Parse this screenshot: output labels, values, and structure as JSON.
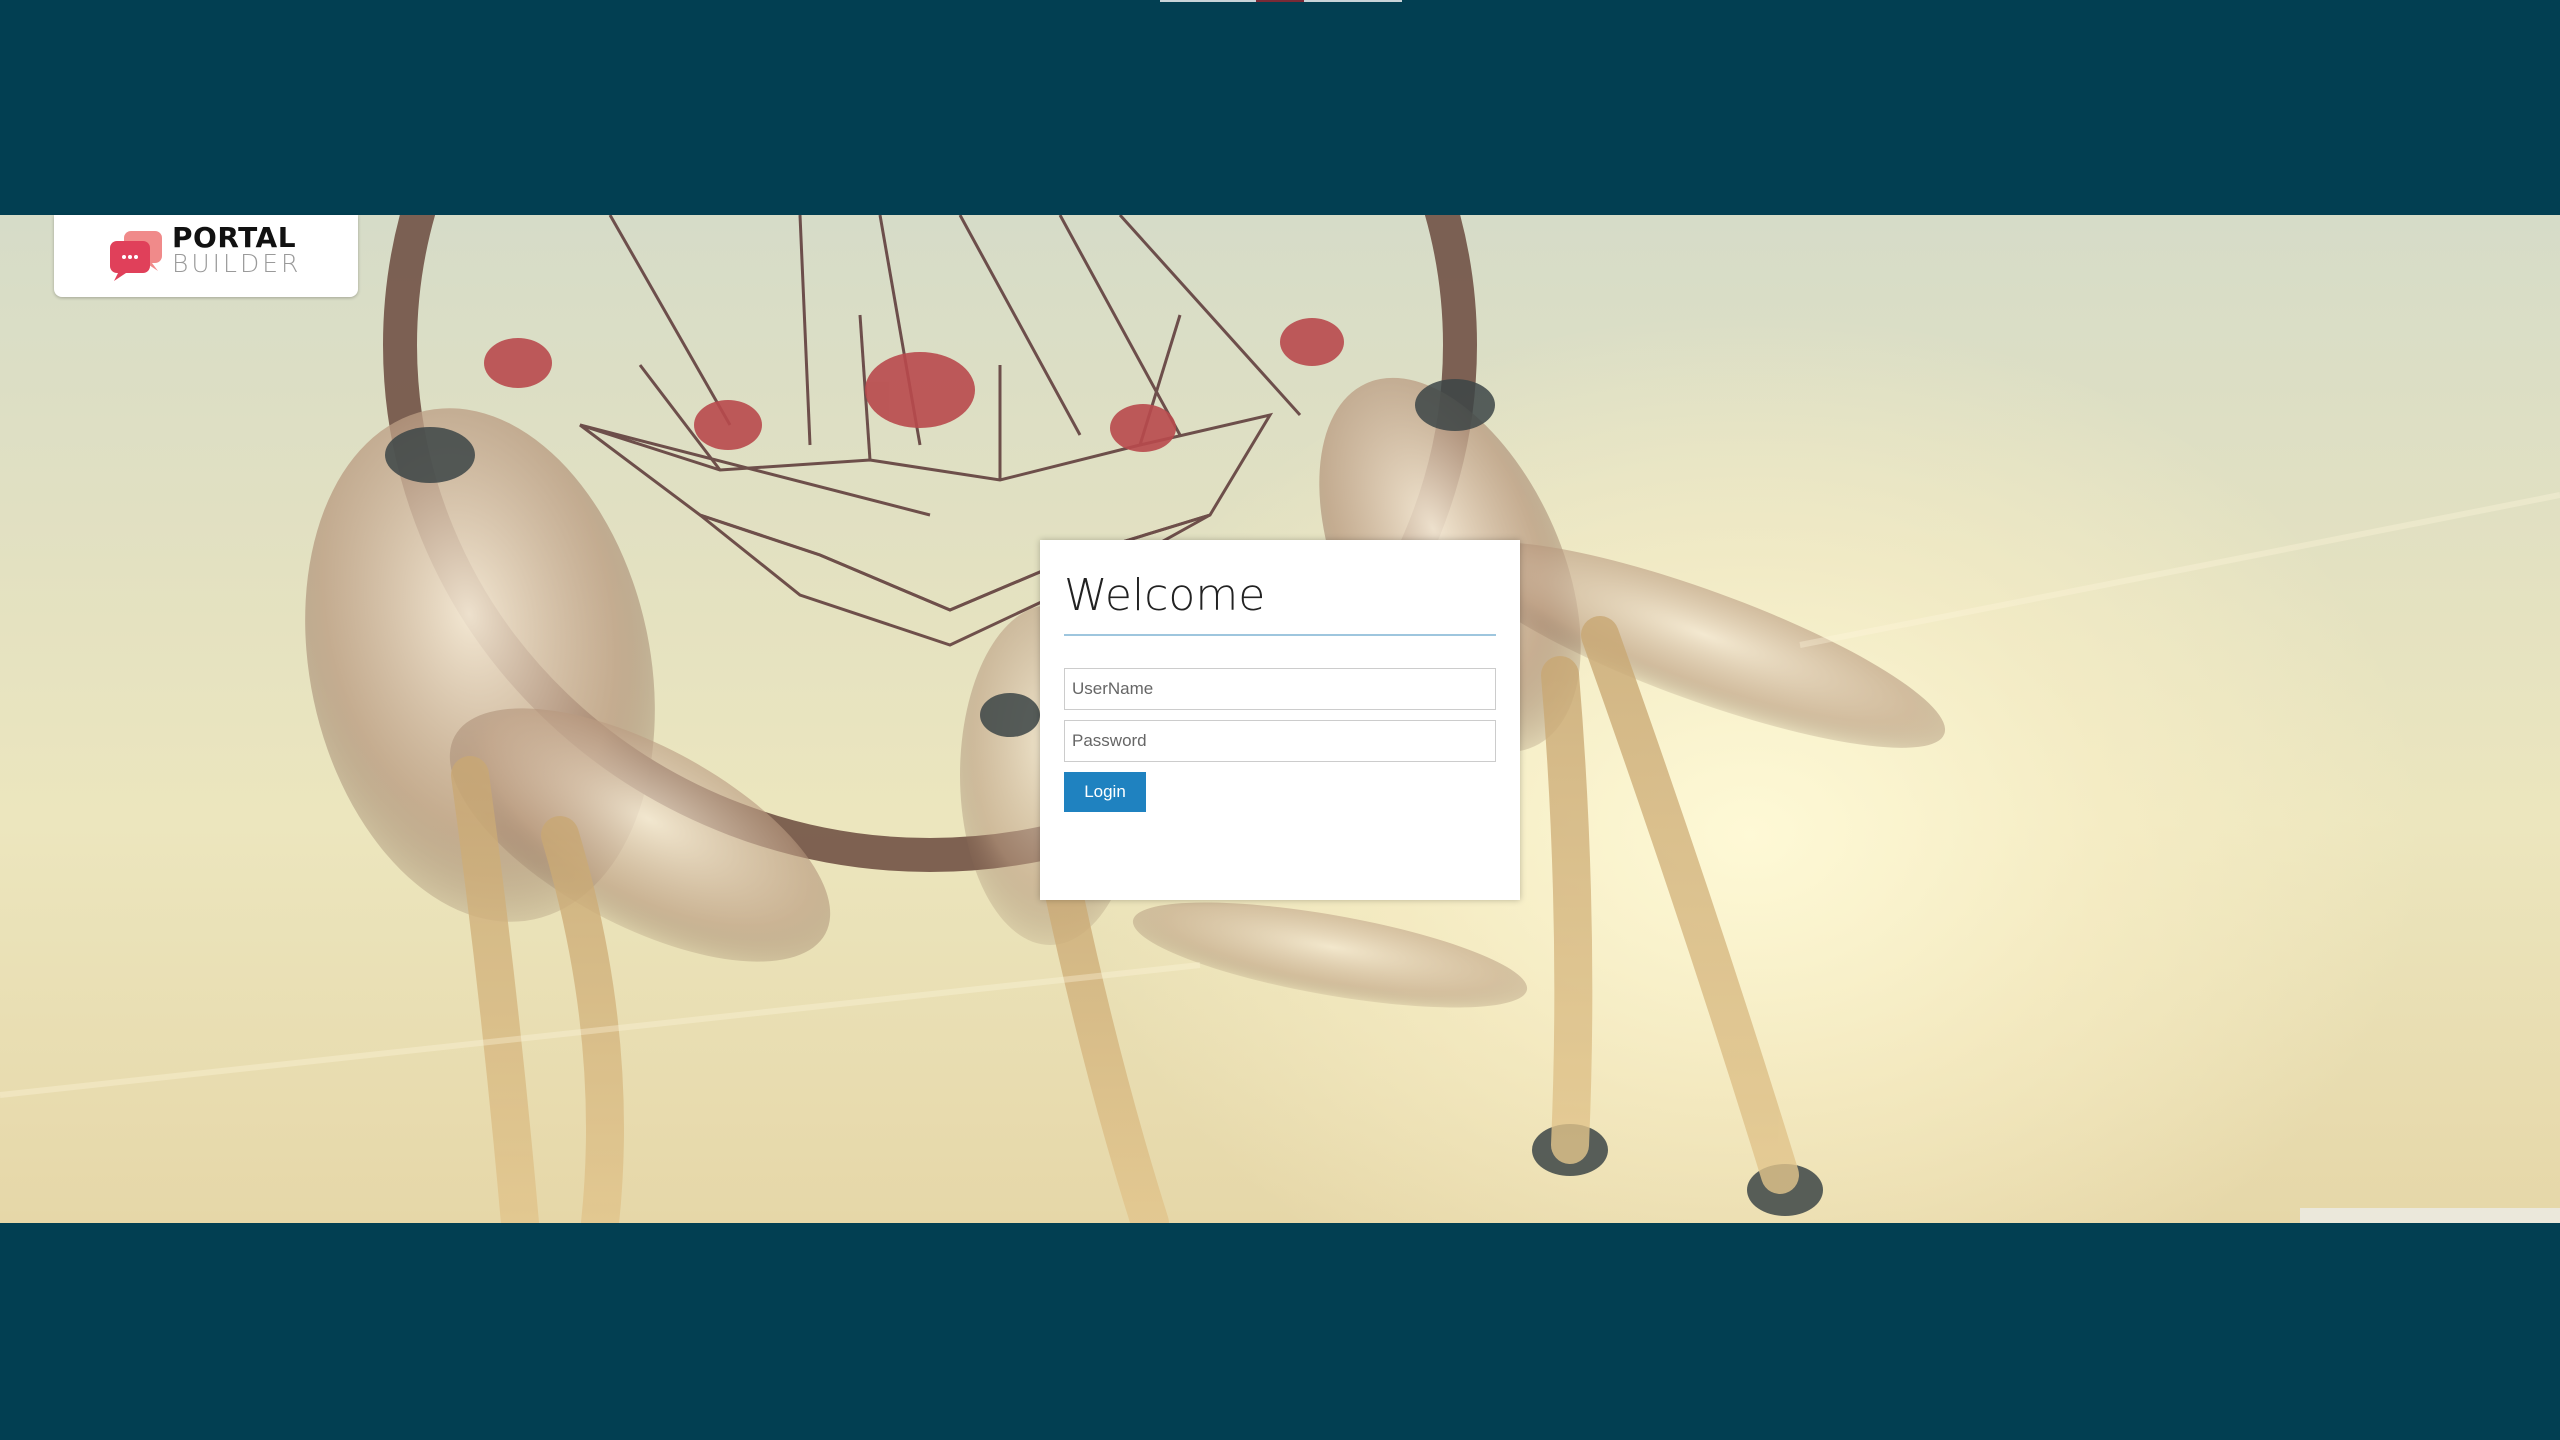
{
  "brand": {
    "logo_line1": "PORTAL",
    "logo_line2": "BUILDER",
    "logo_icon": "chat-bubbles-icon",
    "accent_color": "#e0405a"
  },
  "login": {
    "title": "Welcome",
    "username_placeholder": "UserName",
    "password_placeholder": "Password",
    "button_label": "Login",
    "button_color": "#1f82c0"
  },
  "theme": {
    "page_background": "#023f52",
    "hero_image": "dreamcatcher-feathers-photo"
  }
}
